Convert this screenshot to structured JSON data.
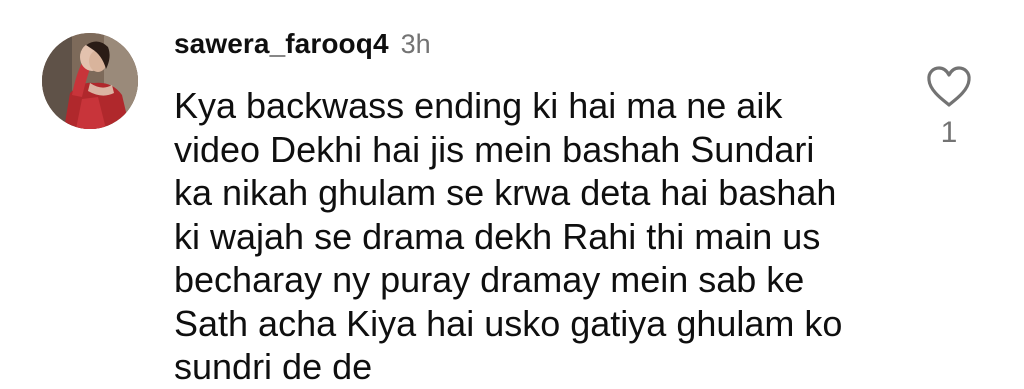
{
  "comment": {
    "username": "sawera_farooq4",
    "timestamp": "3h",
    "text": "Kya backwass ending ki hai ma ne aik\nvideo Dekhi hai jis mein bashah Sundari\nka nikah ghulam se krwa deta hai bashah\nki wajah se drama dekh Rahi thi main us\nbecharay ny puray dramay mein sab ke\nSath acha Kiya hai usko gatiya ghulam ko\nsundri de de",
    "like_count": "1",
    "like_icon": "heart-outline-icon"
  },
  "colors": {
    "text": "#0f0f0f",
    "muted": "#737373",
    "background": "#ffffff"
  }
}
